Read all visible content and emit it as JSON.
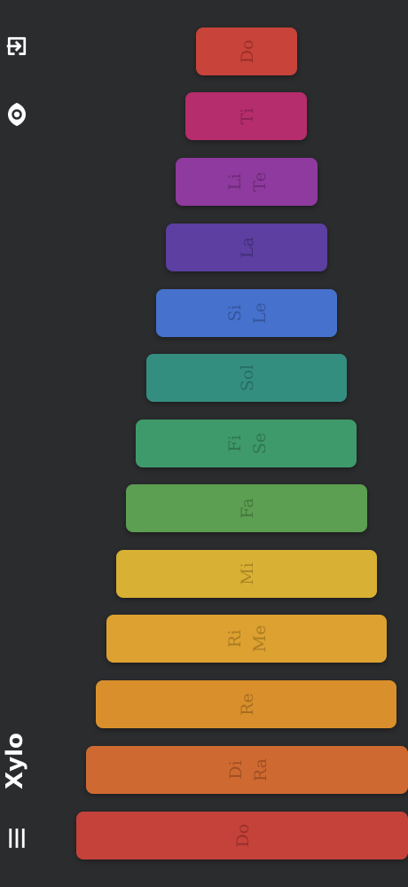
{
  "app": {
    "title": "Xylo"
  },
  "icons": {
    "menu": "menu-icon",
    "visibility": "eye-icon",
    "exit": "exit-icon"
  },
  "colors": {
    "background": "#2b2c2e",
    "icon": "#ffffff"
  },
  "bars": [
    {
      "lines": [
        "Do"
      ],
      "color": "#c8433a",
      "text_color": "#9a2f29"
    },
    {
      "lines": [
        "Ti"
      ],
      "color": "#b52d6c",
      "text_color": "#8a2152"
    },
    {
      "lines": [
        "Li",
        "Te"
      ],
      "color": "#8f3a9e",
      "text_color": "#6c2b78"
    },
    {
      "lines": [
        "La"
      ],
      "color": "#5c3fa0",
      "text_color": "#43307a"
    },
    {
      "lines": [
        "Si",
        "Le"
      ],
      "color": "#4671cc",
      "text_color": "#34559a"
    },
    {
      "lines": [
        "Sol"
      ],
      "color": "#348e80",
      "text_color": "#276c61"
    },
    {
      "lines": [
        "Fi",
        "Se"
      ],
      "color": "#3f9a6b",
      "text_color": "#2f7450"
    },
    {
      "lines": [
        "Fa"
      ],
      "color": "#5c9e52",
      "text_color": "#457a3d"
    },
    {
      "lines": [
        "Mi"
      ],
      "color": "#d8b033",
      "text_color": "#a98626"
    },
    {
      "lines": [
        "Ri",
        "Me"
      ],
      "color": "#dca130",
      "text_color": "#ab7b22"
    },
    {
      "lines": [
        "Re"
      ],
      "color": "#d9902c",
      "text_color": "#a86d20"
    },
    {
      "lines": [
        "Di",
        "Ra"
      ],
      "color": "#ce6a31",
      "text_color": "#a04f23"
    },
    {
      "lines": [
        "Do"
      ],
      "color": "#c5423a",
      "text_color": "#963029"
    }
  ]
}
